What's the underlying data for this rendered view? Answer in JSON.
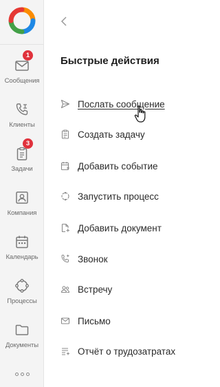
{
  "sidebar": {
    "items": [
      {
        "label": "Сообщения",
        "icon": "envelope-icon",
        "badge": "1"
      },
      {
        "label": "Клиенты",
        "icon": "phone-icon"
      },
      {
        "label": "Задачи",
        "icon": "clipboard-icon",
        "badge": "3"
      },
      {
        "label": "Компания",
        "icon": "company-icon"
      },
      {
        "label": "Календарь",
        "icon": "calendar-icon"
      },
      {
        "label": "Процессы",
        "icon": "process-cycle-icon"
      },
      {
        "label": "Документы",
        "icon": "folder-icon"
      }
    ],
    "more_icon": "more-dots-icon"
  },
  "panel": {
    "title": "Быстрые действия",
    "actions": [
      {
        "label": "Послать сообщение",
        "icon": "send-icon"
      },
      {
        "label": "Создать задачу",
        "icon": "task-icon"
      },
      {
        "label": "Добавить событие",
        "icon": "calendar-add-icon"
      },
      {
        "label": "Запустить процесс",
        "icon": "process-icon"
      },
      {
        "label": "Добавить документ",
        "icon": "document-add-icon"
      },
      {
        "label": "Звонок",
        "icon": "call-icon"
      },
      {
        "label": "Встречу",
        "icon": "meeting-icon"
      },
      {
        "label": "Письмо",
        "icon": "letter-icon"
      },
      {
        "label": "Отчёт о трудозатратах",
        "icon": "report-icon"
      }
    ]
  },
  "colors": {
    "badge": "#e0323c",
    "sidebar_bg": "#f4f4f4",
    "icon": "#7a7a7a",
    "logo": [
      "#e53935",
      "#fb8c00",
      "#1e88e5",
      "#43a047"
    ]
  }
}
